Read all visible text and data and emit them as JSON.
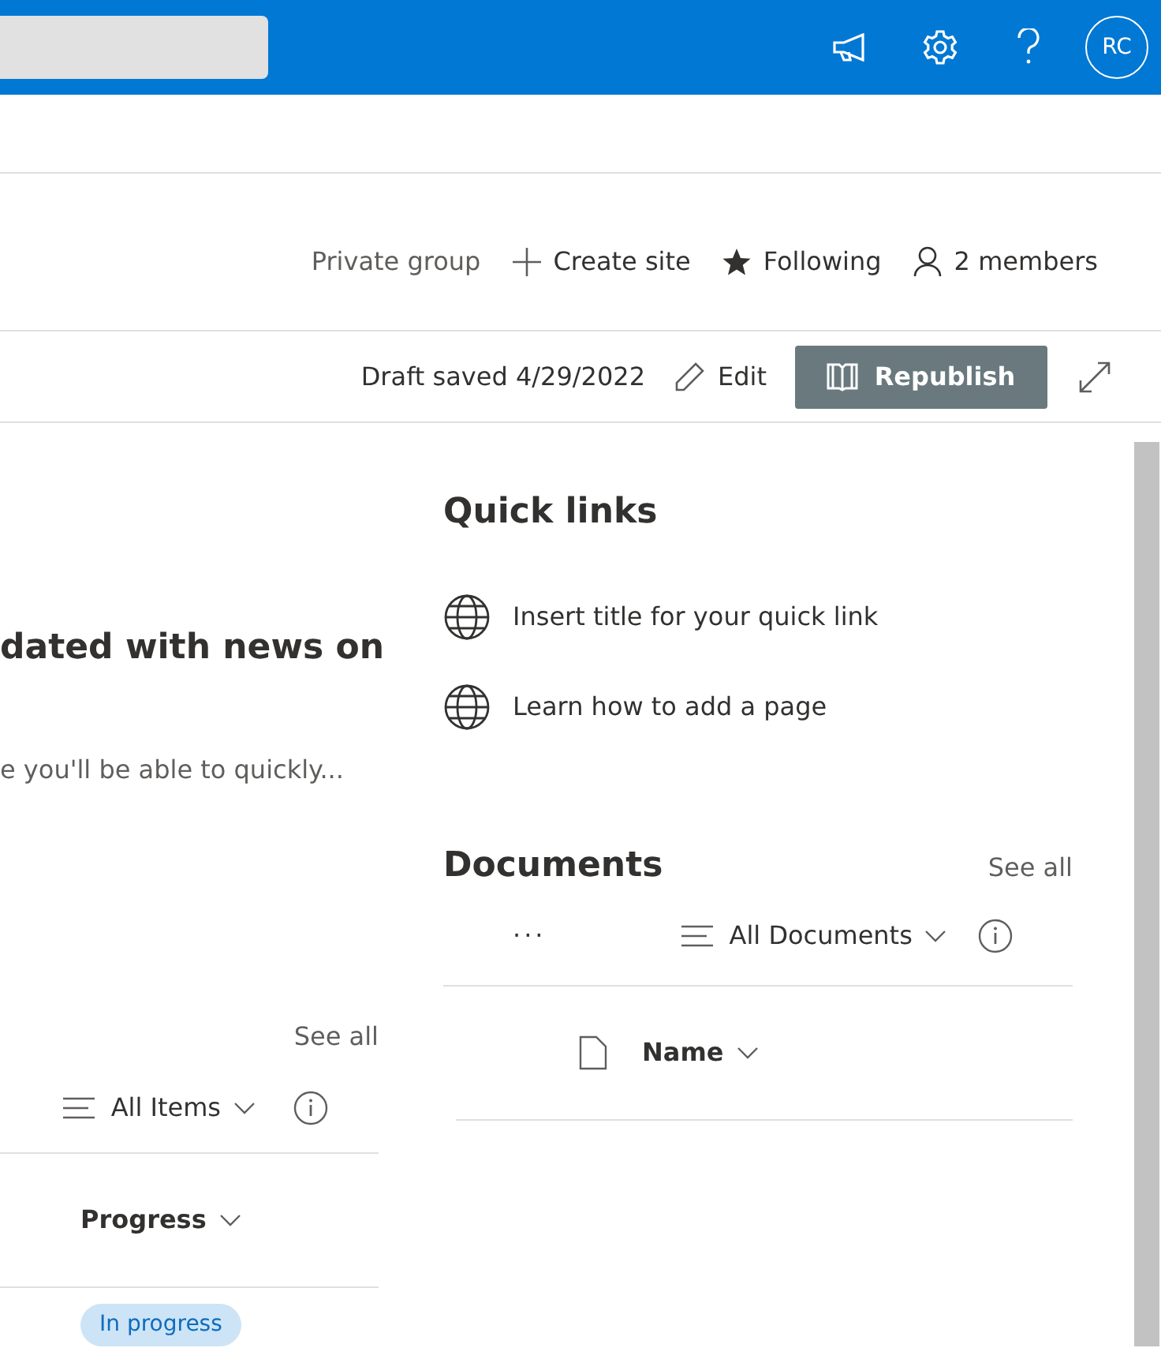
{
  "header": {
    "avatar_initials": "RC"
  },
  "site_actions": [
    {
      "kind": "text",
      "label": "Private group"
    },
    {
      "kind": "create",
      "label": "Create site"
    },
    {
      "kind": "follow",
      "label": "Following"
    },
    {
      "kind": "members",
      "label": "2 members"
    }
  ],
  "command_bar": {
    "draft_status": "Draft saved 4/29/2022",
    "edit": "Edit",
    "republish": "Republish"
  },
  "news": {
    "title": "dated with news on",
    "description": "e you'll be able to quickly..."
  },
  "list": {
    "see_all": "See all",
    "view": "All Items",
    "columns": [
      "Progress"
    ],
    "rows": [
      {
        "progress": "In progress"
      }
    ]
  },
  "quick_links": {
    "title": "Quick links",
    "items": [
      "Insert title for your quick link",
      "Learn how to add a page"
    ]
  },
  "documents": {
    "title": "Documents",
    "see_all": "See all",
    "more": "···",
    "view": "All Documents",
    "columns": [
      "Name"
    ]
  }
}
